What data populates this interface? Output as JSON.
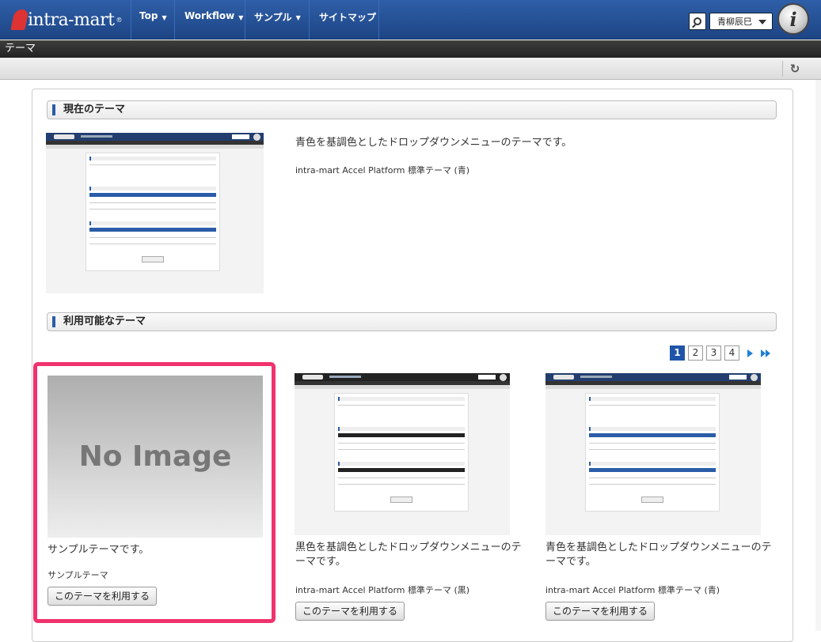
{
  "header": {
    "logo_text": "intra-mart",
    "nav": [
      {
        "label": "Top"
      },
      {
        "label": "Workflow"
      },
      {
        "label": "サンプル"
      },
      {
        "label": "サイトマップ"
      }
    ],
    "user_name": "青柳辰巳",
    "badge": "i"
  },
  "page_title": "テーマ",
  "current_section": {
    "heading": "現在のテーマ",
    "description": "青色を基調色としたドロップダウンメニューのテーマです。",
    "theme_name": "intra-mart Accel Platform 標準テーマ (青)"
  },
  "available_section": {
    "heading": "利用可能なテーマ",
    "pager": {
      "pages": [
        "1",
        "2",
        "3",
        "4"
      ],
      "active": "1"
    },
    "themes": [
      {
        "image_text": "No Image",
        "description": "サンプルテーマです。",
        "name": "サンプルテーマ",
        "button": "このテーマを利用する"
      },
      {
        "description": "黒色を基調色としたドロップダウンメニューのテーマです。",
        "name": "intra-mart Accel Platform 標準テーマ (黒)",
        "button": "このテーマを利用する"
      },
      {
        "description": "青色を基調色としたドロップダウンメニューのテーマです。",
        "name": "intra-mart Accel Platform 標準テーマ (青)",
        "button": "このテーマを利用する"
      }
    ]
  },
  "colors": {
    "header": "#1d4585",
    "highlight": "#f0326d",
    "pager_active": "#1f55a8"
  }
}
